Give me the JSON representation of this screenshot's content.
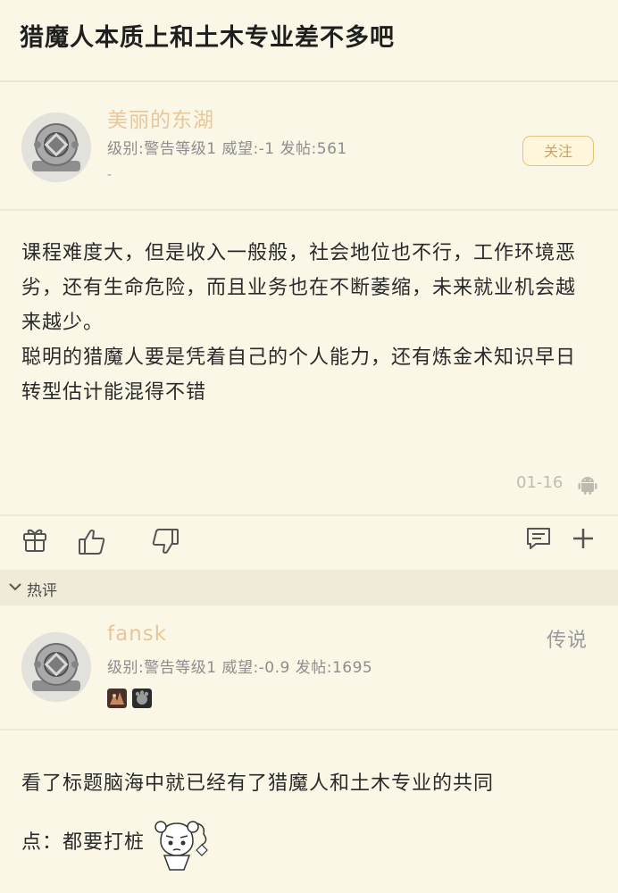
{
  "thread": {
    "title": "猎魔人本质上和土木专业差不多吧"
  },
  "post": {
    "username": "美丽的东湖",
    "meta": "级别:警告等级1 威望:-1 发帖:561",
    "signature": "-",
    "follow_label": "关注",
    "paragraphs": [
      "课程难度大，但是收入一般般，社会地位也不行，工作环境恶劣，还有生命危险，而且业务也在不断萎缩，未来就业机会越来越少。",
      "聪明的猎魔人要是凭着自己的个人能力，还有炼金术知识早日转型估计能混得不错"
    ],
    "time": "01-16",
    "device_icon": "android-icon"
  },
  "actions": {
    "gift_icon": "gift-icon",
    "like_icon": "thumbs-up-icon",
    "dislike_icon": "thumbs-down-icon",
    "comment_icon": "comment-icon",
    "add_icon": "plus-icon"
  },
  "hot_section": {
    "label": "热评"
  },
  "reply": {
    "username": "fansk",
    "rank": "传说",
    "meta": "级别:警告等级1 威望:-0.9 发帖:1695",
    "badges": [
      "badge-icon",
      "badge-icon"
    ],
    "text_line1": "看了标题脑海中就已经有了猎魔人和土木专业的共同",
    "text_line2": "点：都要打桩",
    "sticker": "sticker-icon"
  },
  "colors": {
    "background": "#fbf7e6",
    "username": "#e7c79a",
    "follow_border": "#e7c07a",
    "hot_bar": "#f0ebd9"
  }
}
